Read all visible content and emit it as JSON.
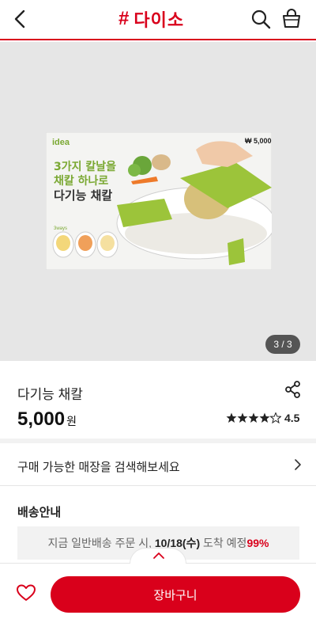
{
  "header": {
    "brand_hash": "#",
    "brand": "다이소",
    "back_icon": "chevron-left-icon",
    "search_icon": "search-icon",
    "cart_icon": "shopping-bag-icon",
    "accent": "#d9001b"
  },
  "gallery": {
    "pager": "3 / 3",
    "image_text": {
      "brand": "idea",
      "headline_1": "3가지 칼날을",
      "headline_2": "채칼 하나로",
      "headline_3": "다기능 채칼",
      "price_badge": "₩ 5,000",
      "ways": "3ways"
    }
  },
  "product": {
    "name": "다기능 채칼",
    "price": "5,000",
    "price_unit": "원",
    "rating": "4.5",
    "rating_value": 4.5,
    "share_icon": "share-icon"
  },
  "store": {
    "label": "구매 가능한 매장을 검색해보세요"
  },
  "delivery": {
    "title": "배송안내",
    "text_before": "지금 일반배송 주문 시,",
    "date": "10/18(수)",
    "text_after": "도착 예정",
    "percent": "99%"
  },
  "bottom": {
    "cart_label": "장바구니",
    "wish_icon": "heart-icon"
  }
}
